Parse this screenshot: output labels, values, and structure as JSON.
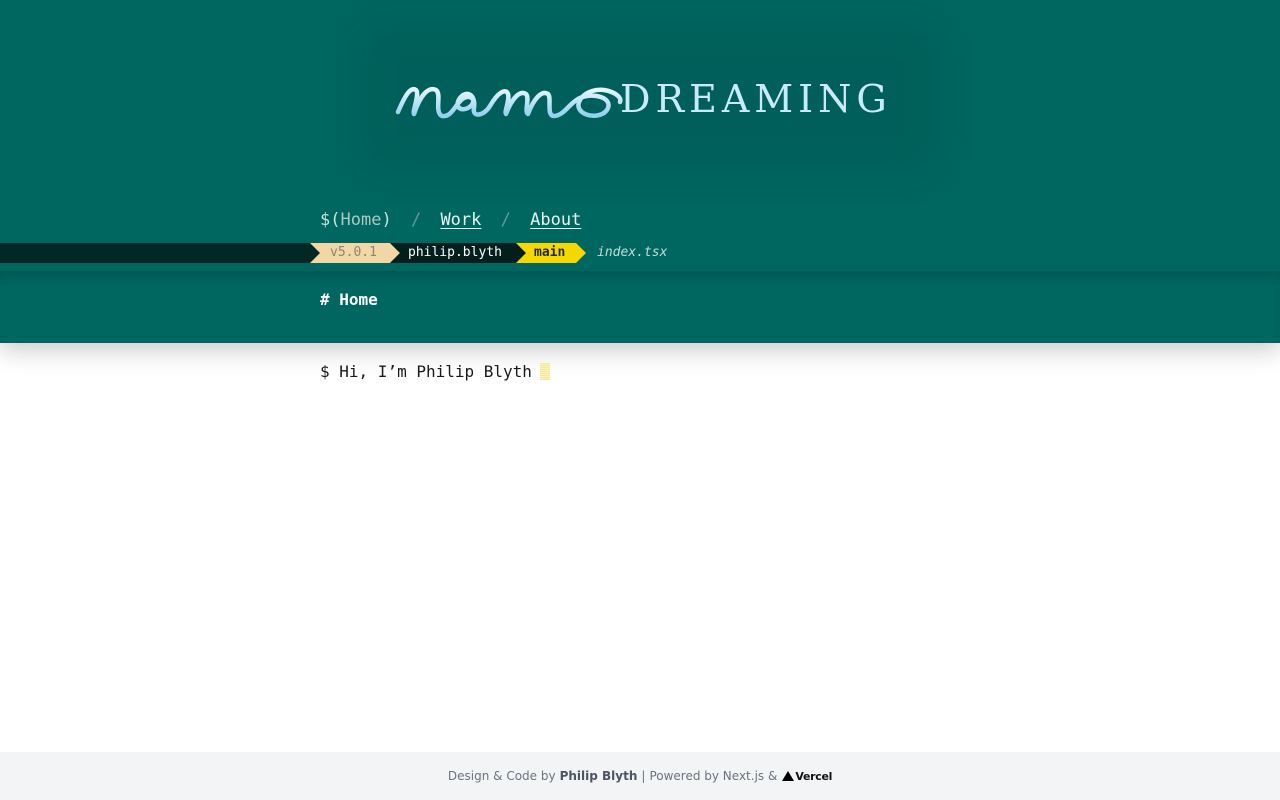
{
  "logo": {
    "script_text": "nemo",
    "word": "DREAMING",
    "gradient_top": "#e6f7fd",
    "gradient_bottom": "#8fd0ef"
  },
  "nav": {
    "prefix": "$(",
    "current": "Home",
    "suffix": ")",
    "separator": "/",
    "links": [
      "Work",
      "About"
    ]
  },
  "statusbar": {
    "version": "v5.0.1",
    "user": "philip.blyth",
    "branch": "main",
    "file": "index.tsx"
  },
  "page": {
    "title": "# Home"
  },
  "main": {
    "prompt": "$ Hi, I’m Philip Blyth"
  },
  "footer": {
    "credit_prefix": "Design & Code by",
    "author": "Philip Blyth",
    "separator": "|",
    "powered": "Powered by Next.js &",
    "vercel": "Vercel"
  },
  "colors": {
    "header_bg": "#006660",
    "accent_yellow": "#f6d800",
    "version_bg": "#f3d6a6",
    "dark_segment": "#021f1d",
    "footer_bg": "#f3f4f6"
  }
}
